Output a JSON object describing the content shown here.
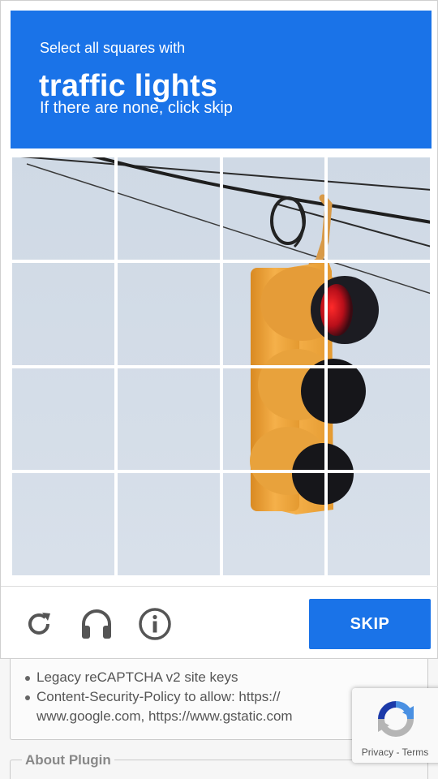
{
  "captcha": {
    "instruction_line1": "Select all squares with",
    "target_object": "traffic lights",
    "instruction_line3": "If there are none, click skip",
    "grid_rows": 4,
    "grid_cols": 4,
    "skip_label": "SKIP",
    "footer_icons": [
      "reload-icon",
      "audio-icon",
      "info-icon"
    ],
    "accent_color": "#1a73e8"
  },
  "background_page": {
    "bullets": [
      "Legacy reCAPTCHA v2 site keys",
      "Content-Security-Policy to allow: https:// www.google.com, https://www.gstatic.com"
    ],
    "section_title": "About Plugin"
  },
  "badge": {
    "links": "Privacy - Terms"
  }
}
